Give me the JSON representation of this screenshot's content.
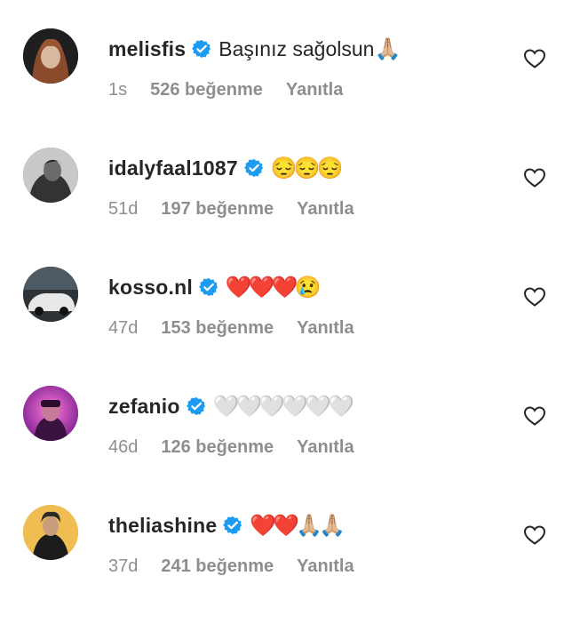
{
  "comments": [
    {
      "username": "melisfis",
      "text": "Başınız sağolsun",
      "emojis": "🙏🏼",
      "time": "1s",
      "likes": "526 beğenme",
      "reply": "Yanıtla",
      "avatar_color": "#2b2b2b"
    },
    {
      "username": "idalyfaal1087",
      "text": "",
      "emojis": "😔😔😔",
      "time": "51d",
      "likes": "197 beğenme",
      "reply": "Yanıtla",
      "avatar_color": "#4a4a4a"
    },
    {
      "username": "kosso.nl",
      "text": "",
      "emojis": "❤️❤️❤️😢",
      "time": "47d",
      "likes": "153 beğenme",
      "reply": "Yanıtla",
      "avatar_color": "#3c4a52"
    },
    {
      "username": "zefanio",
      "text": "",
      "emojis": "🤍🤍🤍🤍🤍🤍",
      "time": "46d",
      "likes": "126 beğenme",
      "reply": "Yanıtla",
      "avatar_color": "#b43aa6"
    },
    {
      "username": "theliashine",
      "text": "",
      "emojis": "❤️❤️🙏🏼🙏🏼",
      "time": "37d",
      "likes": "241 beğenme",
      "reply": "Yanıtla",
      "avatar_color": "#e9b34a"
    }
  ],
  "colors": {
    "verified": "#1d9bf0",
    "text": "#262626",
    "meta": "#8e8e8e"
  },
  "icons": {
    "verified": "verified-badge-icon",
    "like": "heart-outline-icon"
  }
}
